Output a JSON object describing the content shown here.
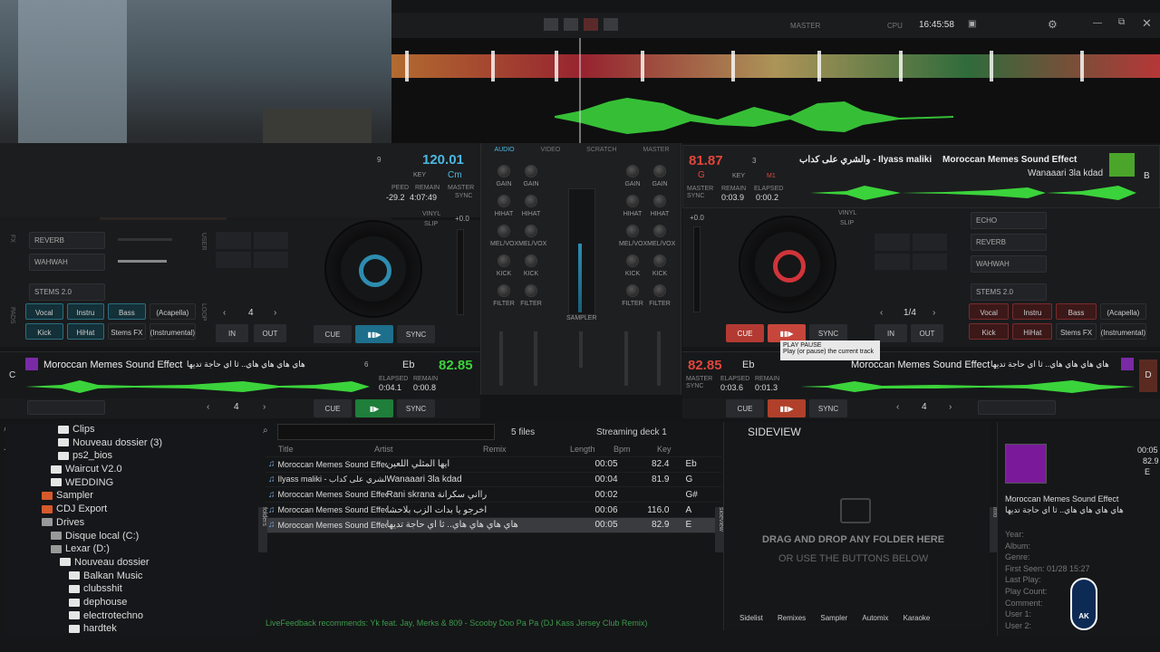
{
  "topbar": {
    "master": "MASTER",
    "cpu": "CPU",
    "time": "16:45:58"
  },
  "deckA": {
    "beat": "9",
    "bpm": "120.01",
    "key_label": "KEY",
    "key": "Cm",
    "pitch_lbl": "PEED",
    "remain_lbl": "REMAIN",
    "master_lbl": "MASTER",
    "pitch": "-29.2",
    "remain": "4:07:49",
    "sync": "SYNC",
    "vinyl": "VINYL",
    "slip": "SLIP",
    "pitchval": "+0.0"
  },
  "deckB": {
    "bpm": "81.87",
    "key": "G",
    "keylbl": "KEY",
    "beat": "3",
    "m1": "M1",
    "title": "Moroccan Memes Sound Effect",
    "title_ar": "والشري على كداب - Ilyass maliki",
    "artist": "Wanaaari 3la kdad",
    "letter": "B",
    "master": "MASTER",
    "sync": "SYNC",
    "remain_lbl": "REMAIN",
    "elapsed_lbl": "ELAPSED",
    "remain": "0:03.9",
    "elapsed": "0:00.2",
    "vinyl": "VINYL",
    "slip": "SLIP",
    "pitchval": "+0.0"
  },
  "mixer": {
    "tabs": [
      "AUDIO",
      "VIDEO",
      "SCRATCH",
      "MASTER"
    ],
    "gain": "GAIN",
    "hihat": "HIHAT",
    "melvox": "MEL/VOX",
    "kick": "KICK",
    "filter": "FILTER",
    "sampler": "SAMPLER"
  },
  "fxA": {
    "fx1": "REVERB",
    "fx2": "WAHWAH",
    "stems": "STEMS 2.0",
    "pads": [
      "Vocal",
      "Instru",
      "Bass",
      "(Acapella)",
      "Kick",
      "HiHat",
      "Stems FX",
      "(Instrumental)"
    ],
    "loop": "4",
    "in": "IN",
    "out": "OUT",
    "cue": "CUE",
    "sync": "SYNC",
    "side_fx": "FX",
    "side_user": "USER",
    "side_pads": "PADS",
    "side_loop": "LOOP"
  },
  "fxB": {
    "fx0": "ECHO",
    "fx1": "REVERB",
    "fx2": "WAHWAH",
    "stems": "STEMS 2.0",
    "pads": [
      "Vocal",
      "Instru",
      "Bass",
      "(Acapella)",
      "Kick",
      "HiHat",
      "Stems FX",
      "(Instrumental)"
    ],
    "loop": "1/4",
    "in": "IN",
    "out": "OUT",
    "cue": "CUE",
    "sync": "SYNC",
    "tooltip_title": "PLAY PAUSE",
    "tooltip_text": "Play (or pause) the current track"
  },
  "deckC": {
    "letter": "C",
    "title": "Moroccan Memes Sound Effect",
    "title_ar": "هاي هاي هاي هاي.. ثا اي حاجة تديها",
    "beat": "6",
    "key": "Eb",
    "bpm": "82.85",
    "elapsed_lbl": "ELAPSED",
    "remain_lbl": "REMAIN",
    "elapsed": "0:04.1",
    "remain": "0:00.8",
    "loop": "4",
    "cue": "CUE",
    "sync": "SYNC"
  },
  "deckD": {
    "letter": "D",
    "bpm": "82.85",
    "key": "Eb",
    "title": "Moroccan Memes Sound Effect",
    "title_ar": "هاي هاي هاي هاي.. ثا اي حاجة تديها",
    "elapsed_lbl": "ELAPSED",
    "remain_lbl": "REMAIN",
    "elapsed": "0:03.6",
    "remain": "0:01.3",
    "loop": "4",
    "cue": "CUE",
    "sync": "SYNC",
    "master": "MASTER",
    "sync_lbl": "SYNC"
  },
  "tree": [
    {
      "label": "Clips",
      "indent": 3
    },
    {
      "label": "Nouveau dossier (3)",
      "indent": 3
    },
    {
      "label": "ps2_bios",
      "indent": 3
    },
    {
      "label": "Waircut V2.0",
      "indent": 2
    },
    {
      "label": "WEDDING",
      "indent": 2
    },
    {
      "label": "Sampler",
      "indent": 1
    },
    {
      "label": "CDJ Export",
      "indent": 1
    },
    {
      "label": "Drives",
      "indent": 1
    },
    {
      "label": "Disque local (C:)",
      "indent": 2
    },
    {
      "label": "Lexar (D:)",
      "indent": 2
    },
    {
      "label": "Nouveau dossier",
      "indent": 3
    },
    {
      "label": "Balkan Music",
      "indent": 4
    },
    {
      "label": "clubsshit",
      "indent": 4
    },
    {
      "label": "dephouse",
      "indent": 4
    },
    {
      "label": "electrotechno",
      "indent": 4
    },
    {
      "label": "hardtek",
      "indent": 4
    }
  ],
  "browser": {
    "files": "5 files",
    "stream": "Streaming deck 1",
    "headers": [
      "Title",
      "Artist",
      "Remix",
      "Length",
      "Bpm",
      "Key"
    ],
    "rows": [
      {
        "title": "Moroccan Memes Sound Effect",
        "artist": "أيها المثلي اللعين",
        "length": "00:05",
        "bpm": "82.4",
        "key": "Eb"
      },
      {
        "title": "Ilyass maliki - والشري على كداب Moroccan Memes Sound Effect",
        "artist": "Wanaaari 3la kdad",
        "length": "00:04",
        "bpm": "81.9",
        "key": "G"
      },
      {
        "title": "Moroccan Memes Sound Effect",
        "artist": "Rani skrana رااني سكرانة",
        "length": "00:02",
        "bpm": "",
        "key": "G#"
      },
      {
        "title": "Moroccan Memes Sound Effect",
        "artist": "اخرجو يا بدات الزب بلاحشا",
        "length": "00:06",
        "bpm": "116.0",
        "key": "A"
      },
      {
        "title": "Moroccan Memes Sound Effect",
        "artist": "هاي هاي هاي هاي.. ثا اي حاجة تديها",
        "length": "00:05",
        "bpm": "82.9",
        "key": "E"
      }
    ],
    "folders_tab": "folders",
    "sideview_tab": "sideview",
    "info_tab": "info"
  },
  "sideview": {
    "title": "SIDEVIEW",
    "drag1": "DRAG AND DROP ANY FOLDER HERE",
    "drag2": "OR USE THE BUTTONS BELOW"
  },
  "info": {
    "length": "00:05",
    "bpm": "82.9",
    "key": "E",
    "title": "Moroccan Memes Sound Effect",
    "artist": "هاي هاي هاي هاي.. ثا اي حاجة تديها",
    "fields": [
      "Year:",
      "Album:",
      "Genre:",
      "First Seen: 01/28 15:27",
      "Last Play:",
      "Play Count:",
      "Comment:",
      "User 1:",
      "User 2:"
    ],
    "logo": "AK"
  },
  "bottom": {
    "live": "LiveFeedback recommends: Yk feat. Jay, Merks & 809 - Scooby Doo Pa Pa (DJ Kass Jersey Club Remix)",
    "tabs": [
      "Sidelist",
      "Remixes",
      "Sampler",
      "Automix",
      "Karaoke"
    ]
  }
}
